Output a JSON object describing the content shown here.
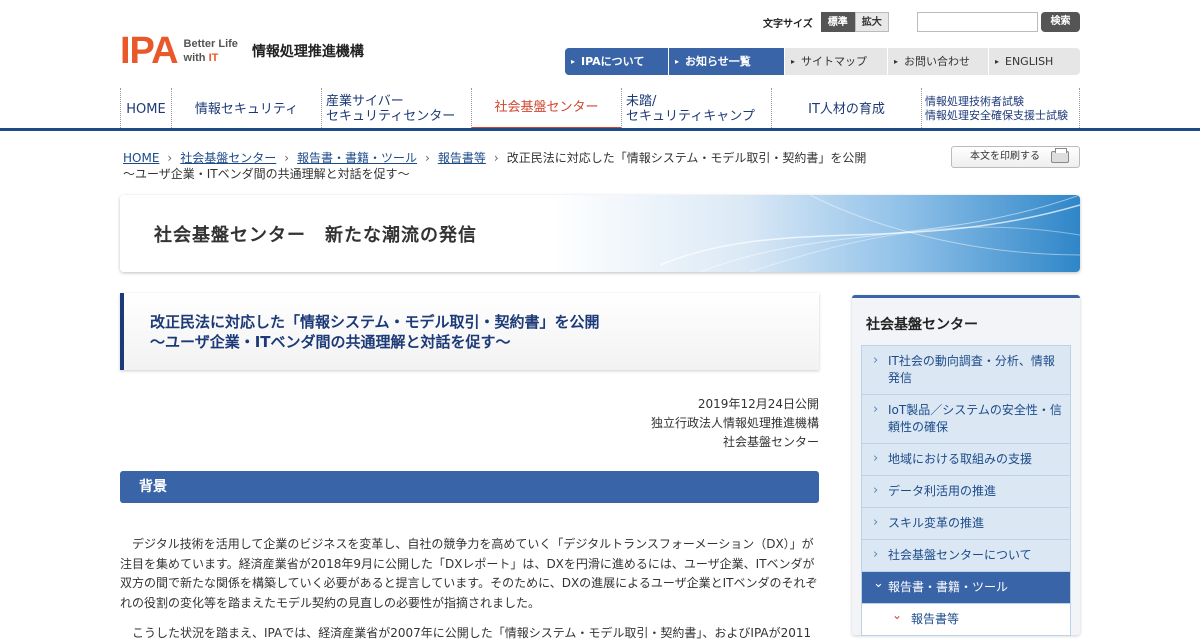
{
  "header": {
    "logo_mark": "IPA",
    "logo_tag_line1": "Better Life",
    "logo_tag_line2_prefix": "with ",
    "logo_tag_line2_it": "IT",
    "org_name": "情報処理推進機構",
    "font_size_label": "文字サイズ",
    "font_size_options": [
      "標準",
      "拡大"
    ],
    "search_button": "検索",
    "util_nav": [
      "IPAについて",
      "お知らせ一覧",
      "サイトマップ",
      "お問い合わせ",
      "ENGLISH"
    ],
    "global_nav": [
      {
        "line1": "HOME",
        "line2": ""
      },
      {
        "line1": "情報セキュリティ",
        "line2": ""
      },
      {
        "line1": "産業サイバー",
        "line2": "セキュリティセンター"
      },
      {
        "line1": "社会基盤センター",
        "line2": ""
      },
      {
        "line1": "未踏/",
        "line2": "セキュリティキャンプ"
      },
      {
        "line1": "IT人材の育成",
        "line2": ""
      },
      {
        "line1": "情報処理技術者試験",
        "line2": "情報処理安全確保支援士試験"
      }
    ]
  },
  "breadcrumb": {
    "links": [
      "HOME",
      "社会基盤センター",
      "報告書・書籍・ツール",
      "報告書等"
    ],
    "current_line1": "改正民法に対応した「情報システム・モデル取引・契約書」を公開",
    "current_line2": "～ユーザ企業・ITベンダ間の共通理解と対話を促す～",
    "print_label": "本文を印刷する"
  },
  "banner": {
    "title": "社会基盤センター　新たな潮流の発信"
  },
  "article": {
    "title_line1": "改正民法に対応した「情報システム・モデル取引・契約書」を公開",
    "title_line2": "～ユーザ企業・ITベンダ間の共通理解と対話を促す～",
    "date": "2019年12月24日公開",
    "publisher": "独立行政法人情報処理推進機構",
    "department": "社会基盤センター",
    "section_title": "背景",
    "paragraph1": "デジタル技術を活用して企業のビジネスを変革し、自社の競争力を高めていく「デジタルトランスフォーメーション（DX）」が注目を集めています。経済産業省が2018年9月に公開した「DXレポート」は、DXを円滑に進めるには、ユーザ企業、ITベンダが双方の間で新たな関係を構築していく必要があると提言しています。そのために、DXの進展によるユーザ企業とITベンダのそれぞれの役割の変化等を踏まえたモデル契約の見直しの必要性が指摘されました。",
    "paragraph2": "こうした状況を踏まえ、IPAでは、経済産業省が2007年に公開した「情報システム・モデル取引・契約書」、およびIPAが2011"
  },
  "sidebar": {
    "title": "社会基盤センター",
    "items": [
      "IT社会の動向調査・分析、情報発信",
      "IoT製品／システムの安全性・信頼性の確保",
      "地域における取組みの支援",
      "データ利活用の推進",
      "スキル変革の推進",
      "社会基盤センターについて",
      "報告書・書籍・ツール"
    ],
    "sub_items": [
      "報告書等"
    ]
  },
  "colors": {
    "brand_orange": "#e8582a",
    "nav_blue": "#1d4b8a",
    "section_blue": "#3a64a8",
    "active_red": "#d0452b"
  }
}
